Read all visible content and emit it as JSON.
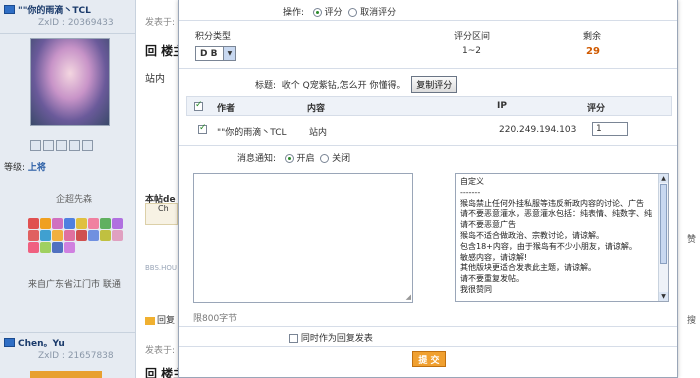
{
  "user1": {
    "name": "\"\"你的雨滴丶TCL",
    "zid": "ZxID : 20369433",
    "level_label": "等级:",
    "level_value": "上将",
    "sign": "企超先森",
    "location": "来自广东省江门市 联通"
  },
  "user2": {
    "name": "Chen。Yu",
    "zid": "ZxID : 21657838"
  },
  "post": {
    "meta": "发表于:",
    "title": "回 楼主",
    "body": "站内",
    "signature_prefix": "本帖de",
    "signature_box": "Ch",
    "bbs_url": "BBS.HOU",
    "reply": "回复",
    "meta2": "发表于:",
    "title2": "回 楼主(丶L)的帖子",
    "right_edge_1": "赞",
    "right_edge_2": "搜"
  },
  "dialog": {
    "operation_label": "操作:",
    "op_rate": "评分",
    "op_cancel": "取消评分",
    "score_type_label": "积分类型",
    "score_type_value": "D B",
    "range_label": "评分区间",
    "range_value": "1~2",
    "remaining_label": "剩余",
    "remaining_value": "29",
    "title_label": "标题:",
    "title_value": "收个 Q宠紫钻,怎么开 你懂得。",
    "copy_button": "复制评分",
    "table": {
      "col_author": "作者",
      "col_content": "内容",
      "col_ip": "IP",
      "col_score": "评分",
      "row_author": "\"\"你的雨滴丶TCL",
      "row_content": "站内",
      "row_ip": "220.249.194.103",
      "row_score": "1"
    },
    "notify_label": "消息通知:",
    "notify_on": "开启",
    "notify_off": "关闭",
    "char_limit": "限800字节",
    "also_reply": "同时作为回复发表",
    "submit": "提 交",
    "reason_lines": [
      "自定义",
      "-------",
      "猴岛禁止任何外挂私服等违反新政内容的讨论、广告",
      "请不要恶意灌水，恶意灌水包括：纯表情、纯数字、纯",
      "请不要恶意广告",
      "猴岛不适合做政治、宗教讨论，请谅解。",
      "包含18+内容，由于猴岛有不少小朋友，请谅解。",
      "敏感内容，请谅解!",
      "其他版块更适合发表此主题，请谅解。",
      "请不要重复发帖。",
      "我很赞同"
    ]
  },
  "colors": {
    "remaining": "#d05a00",
    "submit_bg": "#f0a030",
    "user_name": "#1a3a6b",
    "level_value": "#2a5ea6"
  }
}
